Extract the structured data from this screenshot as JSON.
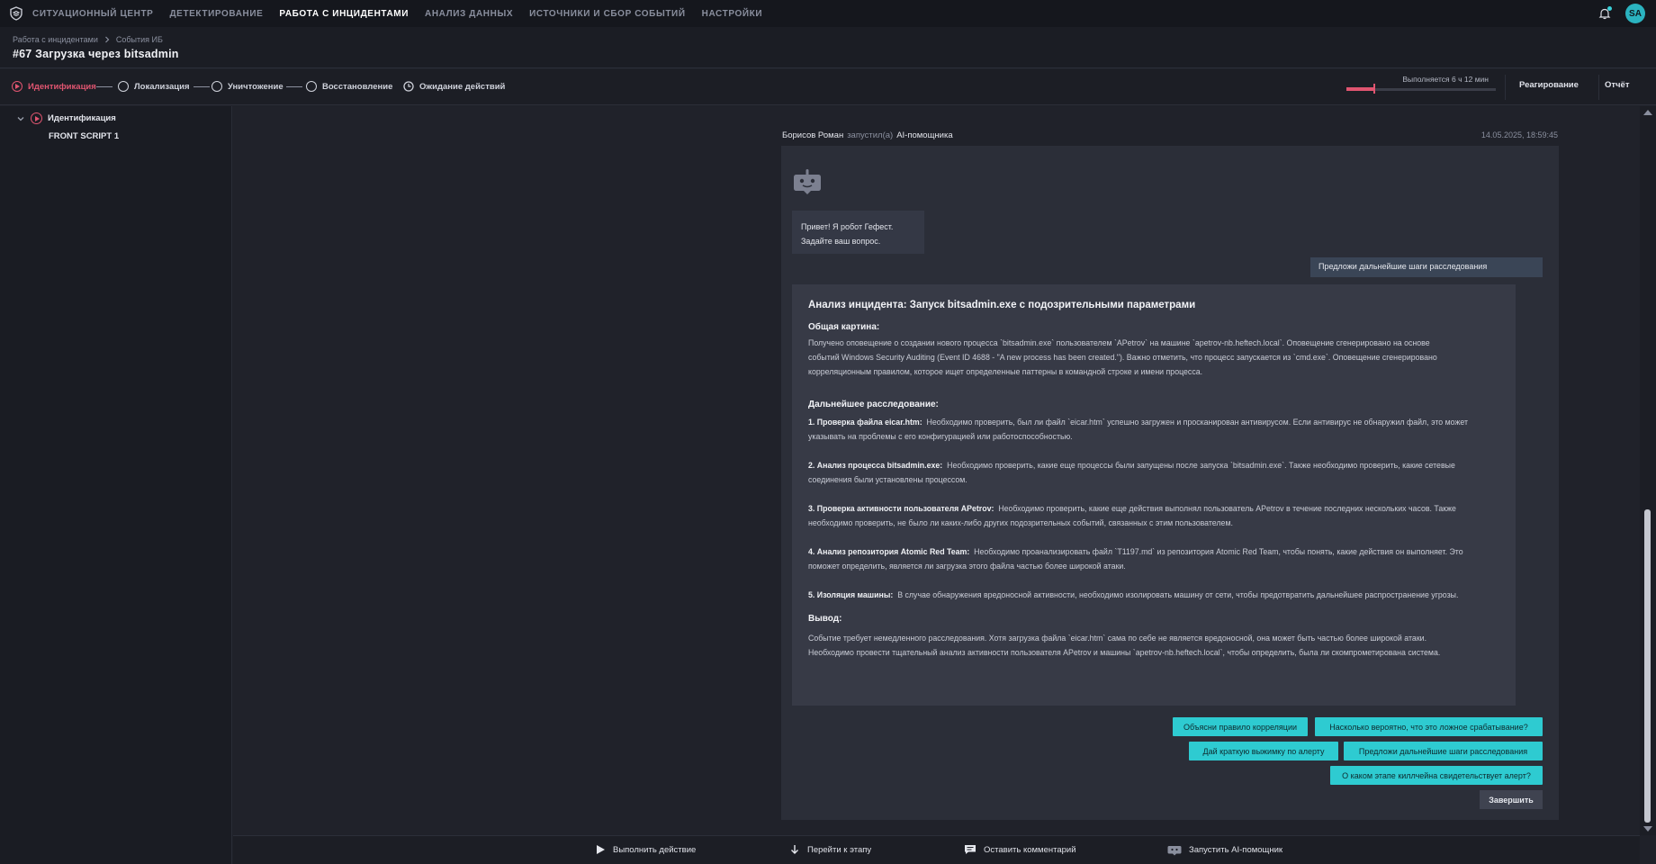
{
  "topnav": {
    "items": [
      {
        "label": "СИТУАЦИОННЫЙ ЦЕНТР",
        "active": false
      },
      {
        "label": "ДЕТЕКТИРОВАНИЕ",
        "active": false
      },
      {
        "label": "РАБОТА С ИНЦИДЕНТАМИ",
        "active": true
      },
      {
        "label": "АНАЛИЗ ДАННЫХ",
        "active": false
      },
      {
        "label": "ИСТОЧНИКИ И СБОР СОБЫТИЙ",
        "active": false
      },
      {
        "label": "НАСТРОЙКИ",
        "active": false
      }
    ],
    "avatar": "SA"
  },
  "header": {
    "breadcrumb": [
      "Работа с инцидентами",
      "События ИБ"
    ],
    "title": "#67 Загрузка через bitsadmin"
  },
  "stages": {
    "items": [
      {
        "label": "Идентификация",
        "active": true
      },
      {
        "label": "Локализация",
        "active": false
      },
      {
        "label": "Уничтожение",
        "active": false
      },
      {
        "label": "Восстановление",
        "active": false
      },
      {
        "label": "Ожидание действий",
        "active": false
      }
    ],
    "progress_label": "Выполняется 6 ч 12 мин",
    "progress_fraction": 0.18,
    "react_label": "Реагирование",
    "report_label": "Отчёт"
  },
  "sidebar": {
    "stage_label": "Идентификация",
    "script_label": "FRONT SCRIPT 1"
  },
  "chat": {
    "author": "Борисов Роман",
    "verb": "запустил(а)",
    "target": "AI-помощника",
    "timestamp": "14.05.2025, 18:59:45",
    "greeting_line1": "Привет! Я робот Гефест.",
    "greeting_line2": "Задайте ваш вопрос.",
    "user_message": "Предложи дальнейшие шаги расследования",
    "answer": {
      "title": "Анализ инцидента: Запуск bitsadmin.exe с подозрительными параметрами",
      "overview_heading": "Общая картина:",
      "overview_line1": "Получено оповещение о создании нового процесса `bitsadmin.exe` пользователем `APetrov` на машине `apetrov-nb.heftech.local`. Оповещение сгенерировано на основе",
      "overview_line2": "событий Windows Security Auditing (Event ID 4688 - \"A new process has been created.\"). Важно отметить, что процесс запускается из `cmd.exe`. Оповещение сгенерировано",
      "overview_line3": "корреляционным правилом, которое ищет определенные паттерны в командной строке и имени процесса.",
      "next_heading": "Дальнейшее расследование:",
      "steps": [
        {
          "title": "1. Проверка файла eicar.htm:",
          "line1": "Необходимо проверить, был ли файл `eicar.htm` успешно загружен и просканирован антивирусом. Если антивирус не обнаружил файл, это может",
          "line2": "указывать на проблемы с его конфигурацией или работоспособностью."
        },
        {
          "title": "2. Анализ процесса bitsadmin.exe:",
          "line1": "Необходимо проверить, какие еще процессы были запущены после запуска `bitsadmin.exe`. Также необходимо проверить, какие сетевые",
          "line2": "соединения были установлены процессом."
        },
        {
          "title": "3. Проверка активности пользователя APetrov:",
          "line1": "Необходимо проверить, какие еще действия выполнял пользователь APetrov в течение последних нескольких часов. Также",
          "line2": "необходимо проверить, не было ли каких-либо других подозрительных событий, связанных с этим пользователем."
        },
        {
          "title": "4. Анализ репозитория Atomic Red Team:",
          "line1": "Необходимо проанализировать файл `T1197.md` из репозитория Atomic Red Team, чтобы понять, какие действия он выполняет. Это",
          "line2": "поможет определить, является ли загрузка этого файла частью более широкой атаки."
        },
        {
          "title": "5. Изоляция машины:",
          "line1": "В случае обнаружения вредоносной активности, необходимо изолировать машину от сети, чтобы предотвратить дальнейшее распространение угрозы.",
          "line2": ""
        }
      ],
      "conclusion_heading": "Вывод:",
      "conclusion_line1": "Событие требует немедленного расследования. Хотя загрузка файла `eicar.htm` сама по себе не является вредоносной, она может быть частью более широкой атаки.",
      "conclusion_line2": "Необходимо провести тщательный анализ активности пользователя APetrov и машины `apetrov-nb.heftech.local`, чтобы определить, была ли скомпрометирована система."
    },
    "suggestions": [
      "Объясни правило корреляции",
      "Насколько вероятно, что это ложное срабатывание?",
      "Дай краткую выжимку по алерту",
      "Предложи дальнейшие шаги расследования",
      "О каком этапе киллчейна свидетельствует алерт?"
    ],
    "finish_label": "Завершить"
  },
  "bottom": {
    "execute": "Выполнить действие",
    "goto_stage": "Перейти к этапу",
    "comment": "Оставить комментарий",
    "run_ai": "Запустить AI-помощник"
  },
  "colors": {
    "accent": "#2ecbd1",
    "danger": "#e05570",
    "background": "#1f2129"
  }
}
